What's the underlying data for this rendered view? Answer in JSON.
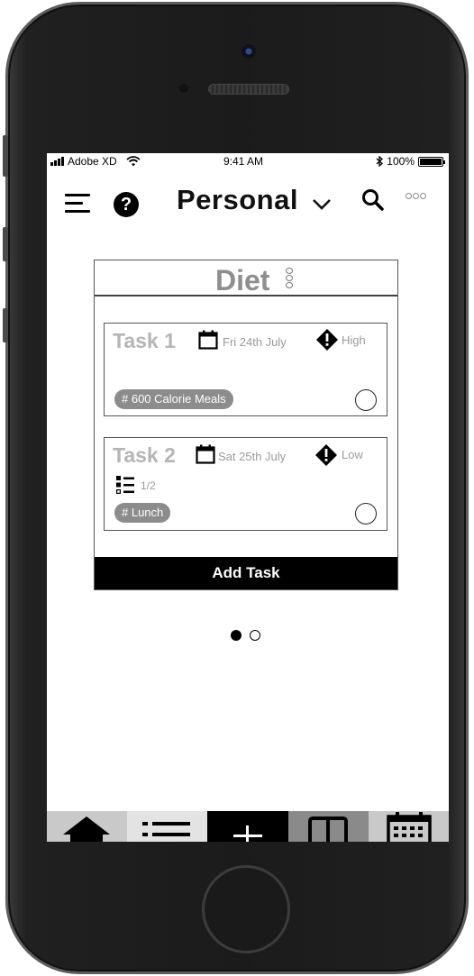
{
  "status_bar": {
    "carrier": "Adobe XD",
    "time": "9:41 AM",
    "battery": "100%",
    "battery_level": 1.0
  },
  "header": {
    "title": "Personal",
    "help_glyph": "?"
  },
  "board": {
    "title": "Diet",
    "tasks": [
      {
        "name": "Task 1",
        "due": "Fri 24th July",
        "priority": "High",
        "tag": "# 600 Calorie Meals"
      },
      {
        "name": "Task 2",
        "due": "Sat 25th July",
        "priority": "Low",
        "subtasks": "1/2",
        "tag": "# Lunch"
      }
    ],
    "add_task_label": "Add Task"
  },
  "pager": {
    "pages": 2,
    "current": 1
  },
  "bottom_nav": {
    "items": [
      "home-icon",
      "list-icon",
      "add-icon",
      "board-icon",
      "calendar-icon"
    ],
    "active": "add-icon"
  },
  "icons": {
    "menu": "hamburger-icon",
    "help": "help-icon",
    "dropdown": "chevron-down-icon",
    "search": "search-icon",
    "more": "more-icon",
    "due": "calendar-icon",
    "priority": "priority-icon",
    "checklist": "checklist-icon",
    "complete": "checkbox-circle-icon"
  },
  "colors": {
    "accent": "#000000",
    "muted_text": "#9a9a9a",
    "tag_bg": "#8c8c8c",
    "board_title": "#8e8e8e"
  }
}
